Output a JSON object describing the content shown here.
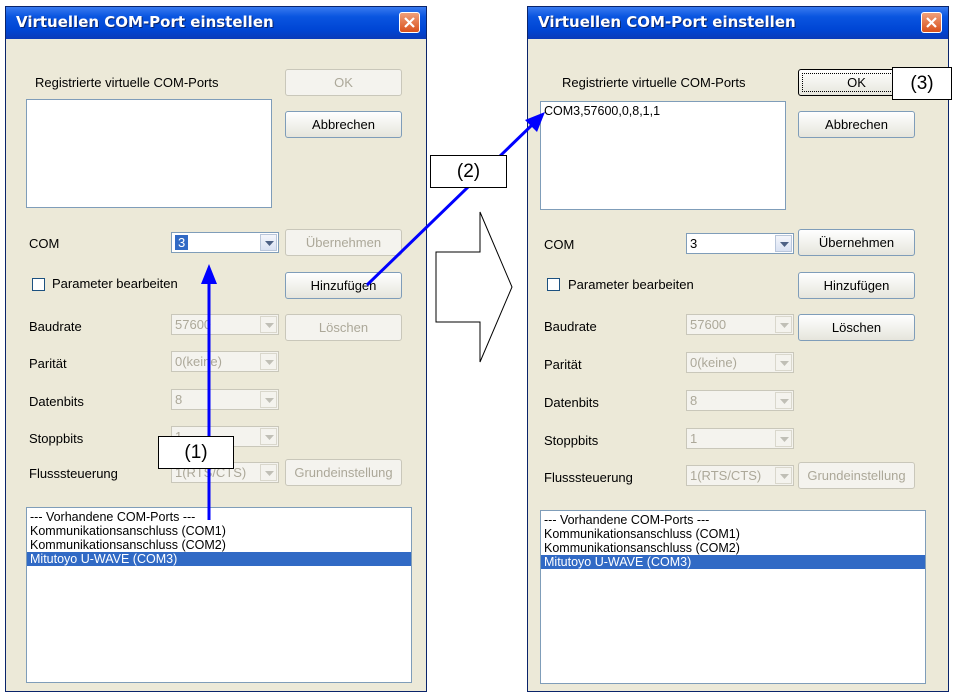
{
  "left": {
    "title": "Virtuellen COM-Port einstellen",
    "registered_label": "Registrierte virtuelle COM-Ports",
    "ok_label": "OK",
    "cancel_label": "Abbrechen",
    "registered_items": [],
    "com_label": "COM",
    "com_value": "3",
    "apply_label": "Übernehmen",
    "edit_params_label": "Parameter bearbeiten",
    "add_label": "Hinzufügen",
    "baud_label": "Baudrate",
    "baud_value": "57600",
    "delete_label": "Löschen",
    "parity_label": "Parität",
    "parity_value": "0(keine)",
    "databits_label": "Datenbits",
    "databits_value": "8",
    "stopbits_label": "Stoppbits",
    "stopbits_value": "1",
    "flow_label": "Flusssteuerung",
    "flow_value": "1(RTS/CTS)",
    "defaults_label": "Grundeinstellung",
    "ports": [
      "--- Vorhandene COM-Ports ---",
      "Kommunikationsanschluss (COM1)",
      "Kommunikationsanschluss (COM2)",
      "Mitutoyo U-WAVE (COM3)"
    ]
  },
  "right": {
    "title": "Virtuellen COM-Port einstellen",
    "registered_label": "Registrierte virtuelle COM-Ports",
    "ok_label": "OK",
    "cancel_label": "Abbrechen",
    "registered_items": [
      "COM3,57600,0,8,1,1"
    ],
    "com_label": "COM",
    "com_value": "3",
    "apply_label": "Übernehmen",
    "edit_params_label": "Parameter bearbeiten",
    "add_label": "Hinzufügen",
    "baud_label": "Baudrate",
    "baud_value": "57600",
    "delete_label": "Löschen",
    "parity_label": "Parität",
    "parity_value": "0(keine)",
    "databits_label": "Datenbits",
    "databits_value": "8",
    "stopbits_label": "Stoppbits",
    "stopbits_value": "1",
    "flow_label": "Flusssteuerung",
    "flow_value": "1(RTS/CTS)",
    "defaults_label": "Grundeinstellung",
    "ports": [
      "--- Vorhandene COM-Ports ---",
      "Kommunikationsanschluss (COM1)",
      "Kommunikationsanschluss (COM2)",
      "Mitutoyo U-WAVE (COM3)"
    ]
  },
  "annotations": {
    "step1": "(1)",
    "step2": "(2)",
    "step3": "(3)"
  },
  "colors": {
    "arrow": "#0000ff",
    "selection": "#316ac5",
    "titlebar": "#0046d5"
  }
}
